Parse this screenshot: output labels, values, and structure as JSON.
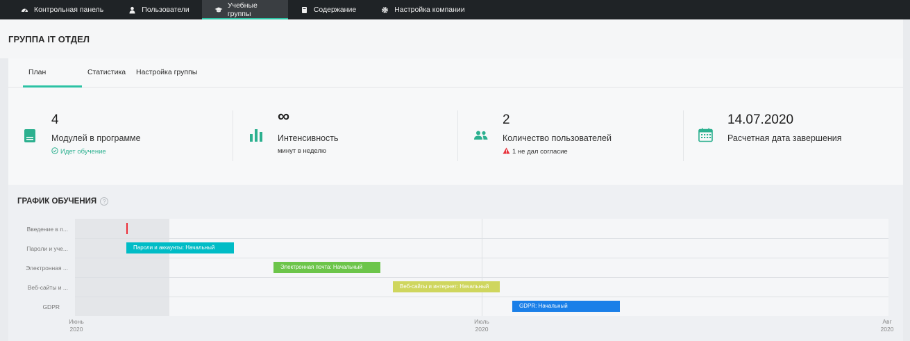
{
  "nav": {
    "items": [
      {
        "label": "Контрольная панель",
        "icon": "dashboard-icon"
      },
      {
        "label": "Пользователи",
        "icon": "user-icon"
      },
      {
        "label": "Учебные группы",
        "icon": "graduation-cap-icon"
      },
      {
        "label": "Содержание",
        "icon": "book-icon"
      },
      {
        "label": "Настройка компании",
        "icon": "gear-icon"
      }
    ]
  },
  "group": {
    "title": "ГРУППА IT ОТДЕЛ"
  },
  "tabs": [
    "План обучения",
    "Статистика",
    "Настройка группы"
  ],
  "stats": {
    "modules": {
      "value": "4",
      "label": "Модулей в программе",
      "sub": "Идет обучение"
    },
    "intensity": {
      "value": "∞",
      "label": "Интенсивность",
      "sub": "минут в неделю"
    },
    "users": {
      "value": "2",
      "label": "Количество пользователей",
      "sub": "1 не дал согласие"
    },
    "end_date": {
      "value": "14.07.2020",
      "label": "Расчетная дата завершения"
    }
  },
  "schedule": {
    "title": "ГРАФИК ОБУЧЕНИЯ",
    "help": "?",
    "rows": [
      {
        "label": "Введение в п...",
        "bar": ""
      },
      {
        "label": "Пароли и уче...",
        "bar": "Пароли и аккаунты: Начальный"
      },
      {
        "label": "Электронная ...",
        "bar": "Электронная почта: Начальный"
      },
      {
        "label": "Веб-сайты и ...",
        "bar": "Веб-сайты и интернет: Начальный"
      },
      {
        "label": "GDPR",
        "bar": "GDPR: Начальный"
      }
    ],
    "axis": [
      {
        "month": "Июнь",
        "year": "2020"
      },
      {
        "month": "Июль",
        "year": "2020"
      },
      {
        "month": "Авг",
        "year": "2020"
      }
    ]
  },
  "colors": {
    "accent": "#2cc2a4",
    "bar_passwords": "#00bcc6",
    "bar_email": "#6cc54a",
    "bar_websites": "#cfd65e",
    "bar_gdpr": "#1a7fe8",
    "marker": "#ec2c36"
  }
}
